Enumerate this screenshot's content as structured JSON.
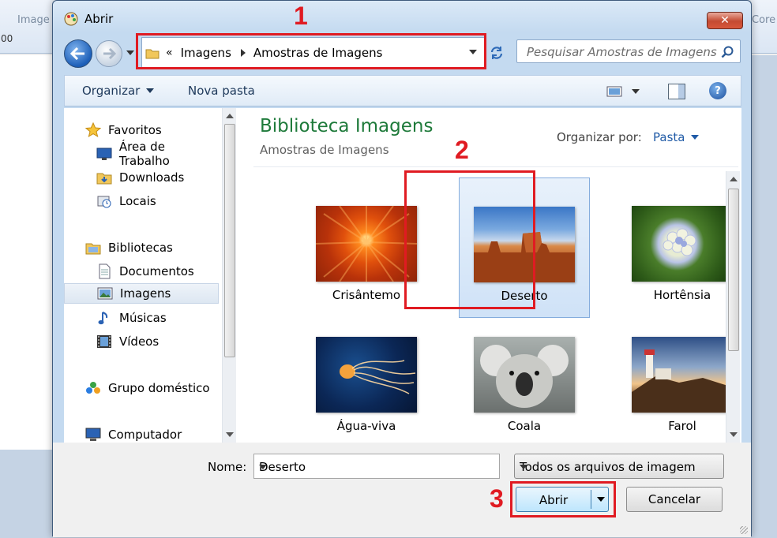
{
  "background_app": {
    "tab_left": "Image",
    "tab_right": "Core",
    "ruler_text": "00"
  },
  "dialog": {
    "title": "Abrir",
    "close_label": "✕"
  },
  "address": {
    "overflow": "«",
    "segments": [
      "Imagens",
      "Amostras de Imagens"
    ]
  },
  "search": {
    "placeholder": "Pesquisar Amostras de Imagens"
  },
  "toolbar": {
    "organize_label": "Organizar",
    "new_folder_label": "Nova pasta",
    "help_label": "?"
  },
  "sidebar": {
    "items": [
      {
        "label": "Favoritos",
        "icon": "star-icon"
      },
      {
        "label": "Área de Trabalho",
        "icon": "desktop-icon"
      },
      {
        "label": "Downloads",
        "icon": "downloads-folder-icon"
      },
      {
        "label": "Locais",
        "icon": "recent-places-icon"
      },
      {
        "label": "Bibliotecas",
        "icon": "libraries-icon"
      },
      {
        "label": "Documentos",
        "icon": "documents-icon"
      },
      {
        "label": "Imagens",
        "icon": "pictures-icon",
        "selected": true
      },
      {
        "label": "Músicas",
        "icon": "music-icon"
      },
      {
        "label": "Vídeos",
        "icon": "videos-icon"
      },
      {
        "label": "Grupo doméstico",
        "icon": "homegroup-icon"
      },
      {
        "label": "Computador",
        "icon": "computer-icon"
      }
    ]
  },
  "main": {
    "library_title": "Biblioteca Imagens",
    "library_subtitle": "Amostras de Imagens",
    "arrange_label": "Organizar por:",
    "arrange_value": "Pasta",
    "files": [
      {
        "name": "Crisântemo"
      },
      {
        "name": "Deserto",
        "selected": true
      },
      {
        "name": "Hortênsia"
      },
      {
        "name": "Água-viva"
      },
      {
        "name": "Coala"
      },
      {
        "name": "Farol"
      }
    ]
  },
  "footer": {
    "name_label": "Nome:",
    "name_value": "Deserto",
    "filter_value": "Todos os arquivos de imagem",
    "open_label": "Abrir",
    "cancel_label": "Cancelar"
  },
  "annotations": [
    "1",
    "2",
    "3"
  ],
  "colors": {
    "annotation_red": "#e01b22",
    "library_title_green": "#1e7a3a",
    "link_blue": "#1f5aa6"
  }
}
